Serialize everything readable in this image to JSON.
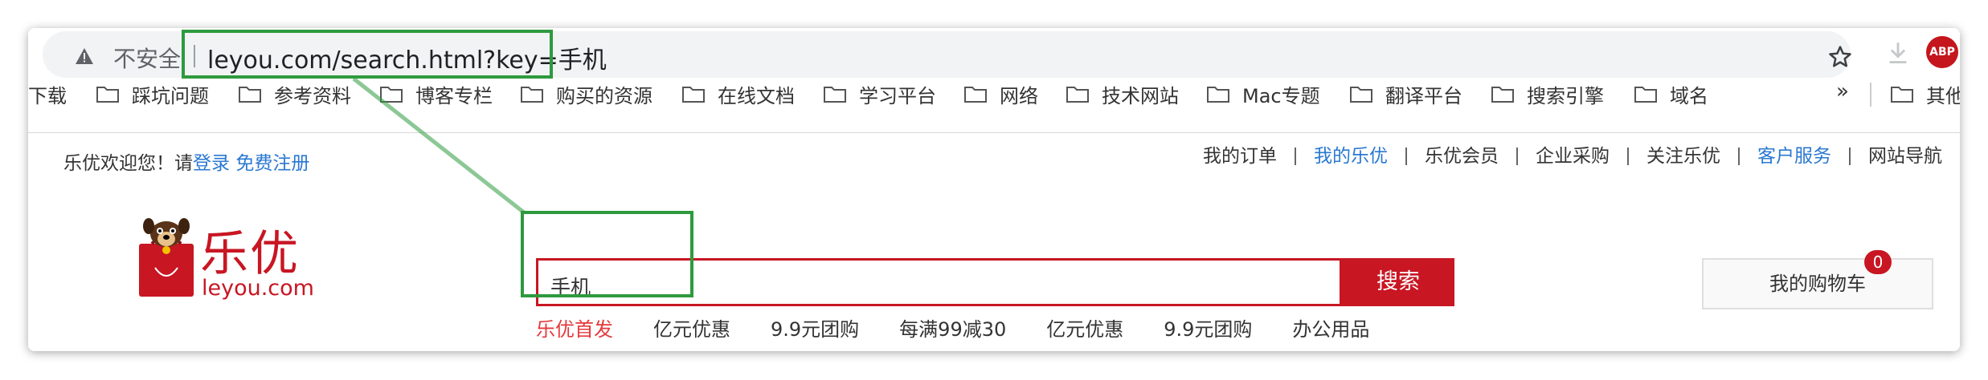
{
  "browser": {
    "security_label": "不安全",
    "url": "leyou.com/search.html?key=手机",
    "abp_label": "ABP",
    "bookmarks": [
      {
        "label": "下载"
      },
      {
        "label": "踩坑问题"
      },
      {
        "label": "参考资料"
      },
      {
        "label": "博客专栏"
      },
      {
        "label": "购买的资源"
      },
      {
        "label": "在线文档"
      },
      {
        "label": "学习平台"
      },
      {
        "label": "网络"
      },
      {
        "label": "技术网站"
      },
      {
        "label": "Mac专题"
      },
      {
        "label": "翻译平台"
      },
      {
        "label": "搜索引擎"
      },
      {
        "label": "域名"
      },
      {
        "label": "其他"
      }
    ],
    "overflow_label": "»",
    "icons": [
      "warning-icon",
      "star-icon",
      "download-icon",
      "adblock-icon",
      "folder-icon"
    ]
  },
  "site": {
    "welcome_prefix": "乐优欢迎您！请",
    "login_link": "登录",
    "register_link": "免费注册",
    "topnav": [
      {
        "label": "我的订单",
        "highlight": false
      },
      {
        "label": "我的乐优",
        "highlight": true
      },
      {
        "label": "乐优会员",
        "highlight": false
      },
      {
        "label": "企业采购",
        "highlight": false
      },
      {
        "label": "关注乐优",
        "highlight": false
      },
      {
        "label": "客户服务",
        "highlight": true
      },
      {
        "label": "网站导航",
        "highlight": false
      }
    ],
    "logo": {
      "chinese": "乐优",
      "domain": "leyou.com"
    },
    "search": {
      "value": "手机",
      "button_label": "搜索"
    },
    "hotwords": [
      "乐优首发",
      "亿元优惠",
      "9.9元团购",
      "每满99减30",
      "亿元优惠",
      "9.9元团购",
      "办公用品"
    ],
    "cart": {
      "label": "我的购物车",
      "count": "0"
    }
  },
  "colors": {
    "brand_red": "#c81623",
    "link_blue": "#2a78d1",
    "annotation_green": "#2e9a3e"
  }
}
